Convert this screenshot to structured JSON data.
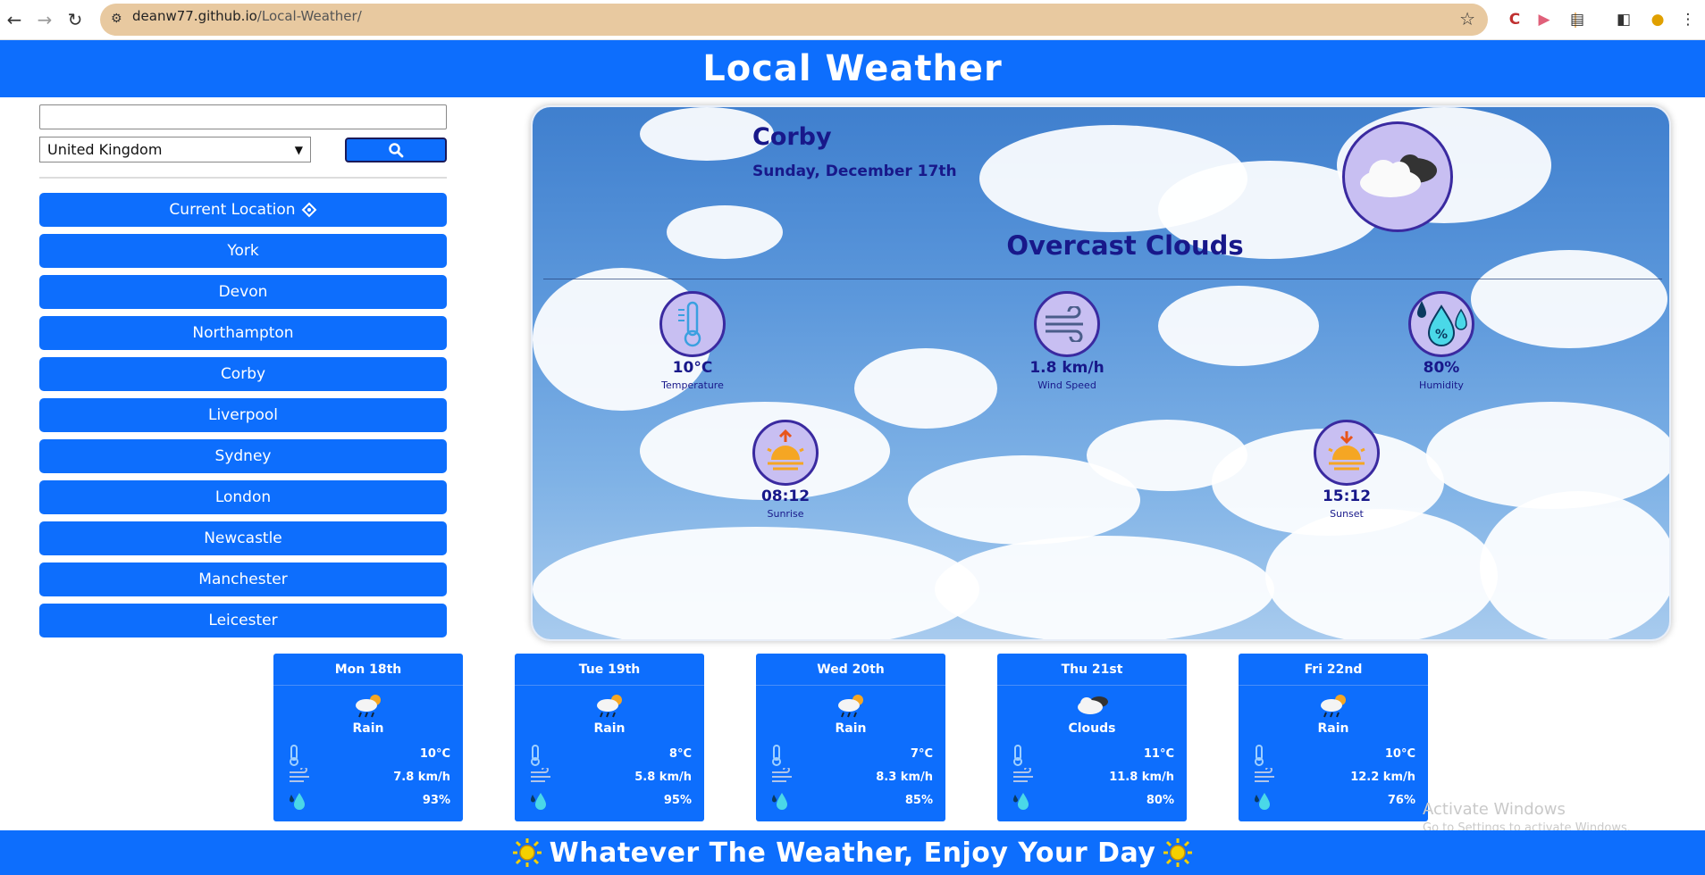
{
  "browser": {
    "url_host": "deanw77.github.io",
    "url_path": "/Local-Weather/"
  },
  "header": {
    "title": "Local Weather"
  },
  "sidebar": {
    "search": {
      "value": "",
      "placeholder": ""
    },
    "country": {
      "selected": "United Kingdom"
    },
    "search_button_icon": "search-icon",
    "current_location_label": "Current Location",
    "cities": [
      "York",
      "Devon",
      "Northampton",
      "Corby",
      "Liverpool",
      "Sydney",
      "London",
      "Newcastle",
      "Manchester",
      "Leicester"
    ]
  },
  "current": {
    "city": "Corby",
    "date": "Sunday, December 17th",
    "description": "Overcast Clouds",
    "icon": "overcast-clouds-icon",
    "temperature": {
      "value": "10°C",
      "label": "Temperature"
    },
    "wind": {
      "value": "1.8 km/h",
      "label": "Wind Speed"
    },
    "humidity": {
      "value": "80%",
      "label": "Humidity"
    },
    "sunrise": {
      "value": "08:12",
      "label": "Sunrise"
    },
    "sunset": {
      "value": "15:12",
      "label": "Sunset"
    }
  },
  "forecast": [
    {
      "day": "Mon 18th",
      "desc": "Rain",
      "icon": "rain-icon",
      "temp": "10°C",
      "wind": "7.8 km/h",
      "humidity": "93%"
    },
    {
      "day": "Tue 19th",
      "desc": "Rain",
      "icon": "rain-icon",
      "temp": "8°C",
      "wind": "5.8 km/h",
      "humidity": "95%"
    },
    {
      "day": "Wed 20th",
      "desc": "Rain",
      "icon": "rain-icon",
      "temp": "7°C",
      "wind": "8.3 km/h",
      "humidity": "85%"
    },
    {
      "day": "Thu 21st",
      "desc": "Clouds",
      "icon": "clouds-icon",
      "temp": "11°C",
      "wind": "11.8 km/h",
      "humidity": "80%"
    },
    {
      "day": "Fri 22nd",
      "desc": "Rain",
      "icon": "rain-icon",
      "temp": "10°C",
      "wind": "12.2 km/h",
      "humidity": "76%"
    }
  ],
  "footer": {
    "text": "Whatever The Weather, Enjoy Your Day"
  },
  "os_watermark": {
    "line1": "Activate Windows",
    "line2": "Go to Settings to activate Windows."
  },
  "colors": {
    "primary": "#0d6efd",
    "text_dark": "#18188a",
    "icon_bg": "#c8bff2",
    "urlbar": "#e8c9a0"
  }
}
